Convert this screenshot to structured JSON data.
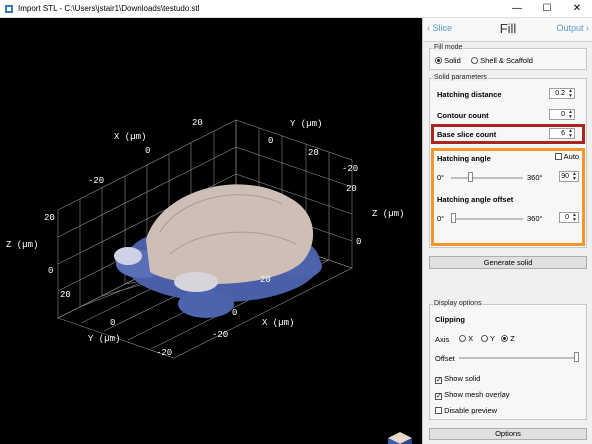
{
  "window": {
    "title": "Import STL - C:\\Users\\jstair1\\Downloads\\testudo.stl",
    "minimize": "—",
    "maximize": "☐",
    "close": "✕"
  },
  "viewport": {
    "axis_labels": {
      "x_top": "X (µm)",
      "y_top": "Y (µm)",
      "z_left": "Z (µm)",
      "z_right": "Z (µm)",
      "x_bottom": "X (µm)",
      "y_bottom": "Y (µm)"
    },
    "ticks": {
      "x_top": [
        "-20",
        "0",
        "20"
      ],
      "y_top": [
        "0",
        "20",
        "-20"
      ],
      "z_left": [
        "0",
        "20"
      ],
      "z_right": [
        "0",
        "20"
      ],
      "x_bottom": [
        "20",
        "0",
        "-20"
      ],
      "y_bottom": [
        "20",
        "0",
        "-20"
      ]
    }
  },
  "nav": {
    "prev": "Slice",
    "title": "Fill",
    "next": "Output"
  },
  "fill_mode": {
    "label": "Fill mode",
    "options": [
      "Solid",
      "Shell & Scaffold"
    ],
    "selected": "Solid"
  },
  "solid_parameters": {
    "label": "Solid parameters",
    "hatching_distance": {
      "label": "Hatching distance",
      "value": "0.2"
    },
    "contour_count": {
      "label": "Contour count",
      "value": "0"
    },
    "base_slice_count": {
      "label": "Base slice count",
      "value": "6"
    },
    "hatching_angle": {
      "label": "Hatching angle",
      "auto_label": "Auto",
      "auto": false,
      "min": "0°",
      "max": "360°",
      "value": "90",
      "fraction": 0.25
    },
    "hatching_angle_offset": {
      "label": "Hatching angle offset",
      "min": "0°",
      "max": "360°",
      "value": "0",
      "fraction": 0.0
    }
  },
  "generate_button": "Generate solid",
  "display_options": {
    "label": "Display options",
    "clipping": "Clipping",
    "axis_label": "Axis",
    "axes": [
      "X",
      "Y",
      "Z"
    ],
    "selected_axis": "Z",
    "offset_label": "Offset",
    "offset_fraction": 1.0,
    "show_solid": {
      "label": "Show solid",
      "checked": true
    },
    "show_mesh": {
      "label": "Show mesh overlay",
      "checked": true
    },
    "disable_preview": {
      "label": "Disable preview",
      "checked": false
    }
  },
  "options_button": "Options",
  "colors": {
    "highlight_red": "#a8261c",
    "highlight_orange": "#f0962d",
    "nav_link": "#5b9bd5"
  }
}
